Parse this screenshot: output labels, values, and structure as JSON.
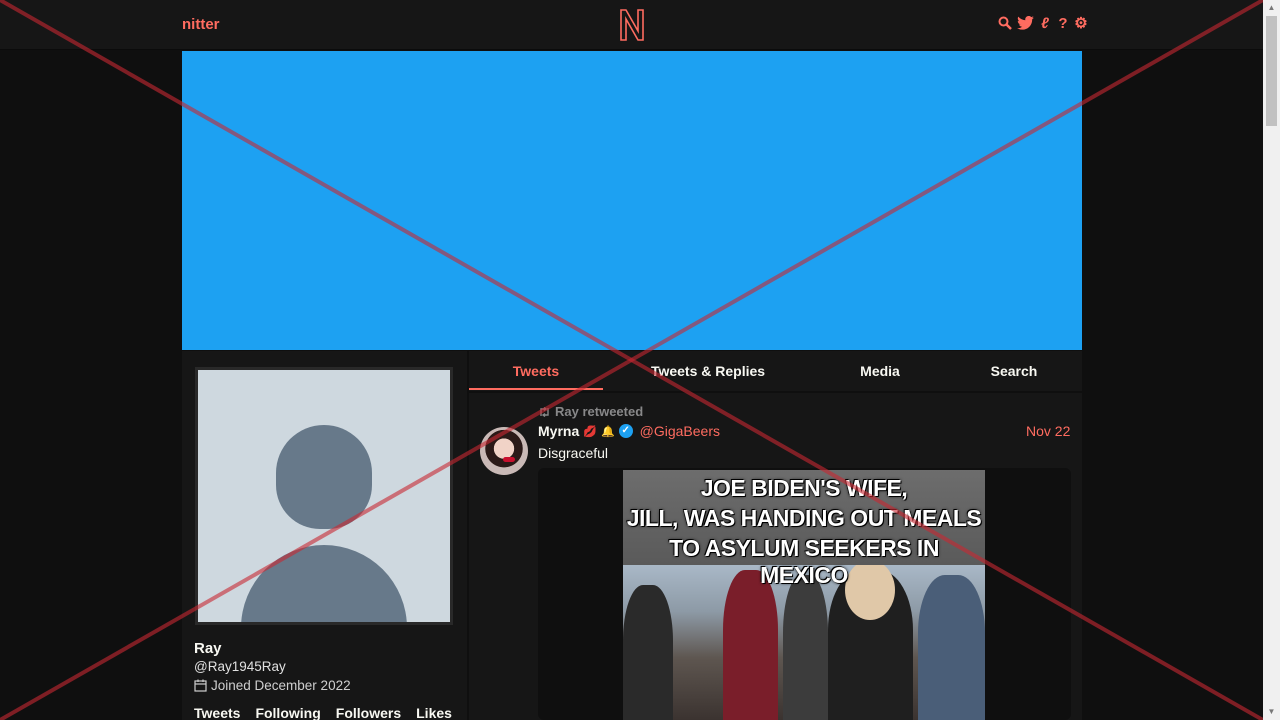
{
  "nav": {
    "brand": "nitter",
    "icons": [
      "search-icon",
      "twitter-icon",
      "rss-icon",
      "help-icon",
      "settings-icon"
    ]
  },
  "profile": {
    "name": "Ray",
    "handle": "@Ray1945Ray",
    "joined": "Joined December 2022",
    "stats": [
      "Tweets",
      "Following",
      "Followers",
      "Likes"
    ]
  },
  "tabs": [
    {
      "label": "Tweets",
      "active": true
    },
    {
      "label": "Tweets & Replies",
      "active": false
    },
    {
      "label": "Media",
      "active": false
    },
    {
      "label": "Search",
      "active": false
    }
  ],
  "tweet": {
    "retweet_label": "Ray retweeted",
    "fullname": "Myrna",
    "handle": "@GigaBeers",
    "date": "Nov 22",
    "text": "Disgraceful",
    "meme_lines": [
      "JOE BIDEN'S WIFE,",
      "JILL, WAS HANDING OUT MEALS",
      "TO ASYLUM SEEKERS IN MEXICO"
    ]
  },
  "colors": {
    "accent": "#ff6c60",
    "banner": "#1da1f2",
    "background": "#0f0f0f",
    "panel": "#161616"
  }
}
